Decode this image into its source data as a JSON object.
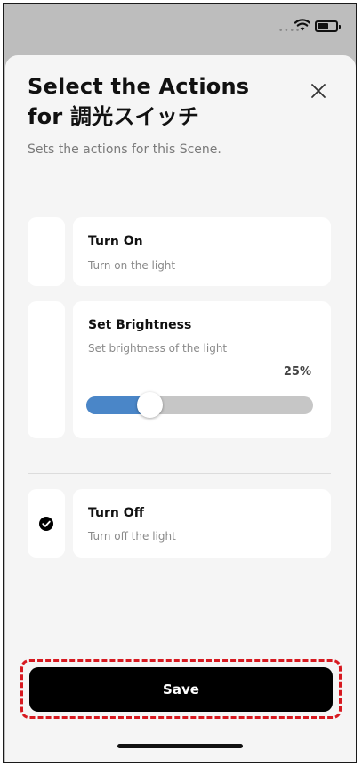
{
  "status_bar": {
    "signal_dots": "••••",
    "wifi_icon": "wifi-icon",
    "battery_icon": "battery-icon"
  },
  "sheet": {
    "title": "Select the Actions for 調光スイッチ",
    "close_icon": "close-icon",
    "subtitle": "Sets the actions for this Scene."
  },
  "actions": [
    {
      "title": "Turn On",
      "description": "Turn on the light",
      "selected": false
    },
    {
      "title": "Set Brightness",
      "description": "Set brightness of the light",
      "selected": false,
      "value_label": "25%",
      "value": 25
    },
    {
      "title": "Turn Off",
      "description": "Turn off the light",
      "selected": true
    }
  ],
  "save_label": "Save",
  "colors": {
    "accent": "#4a86c8",
    "highlight": "#d71920",
    "button": "#000000"
  }
}
